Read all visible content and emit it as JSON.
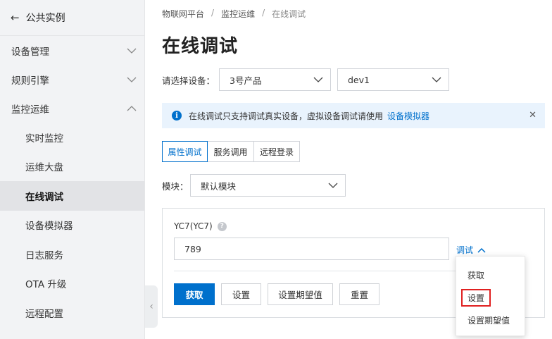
{
  "sidebar": {
    "back_label": "公共实例",
    "groups": [
      {
        "label": "设备管理"
      },
      {
        "label": "规则引擎"
      },
      {
        "label": "监控运维"
      }
    ],
    "subitems": [
      {
        "label": "实时监控"
      },
      {
        "label": "运维大盘"
      },
      {
        "label": "在线调试"
      },
      {
        "label": "设备模拟器"
      },
      {
        "label": "日志服务"
      },
      {
        "label": "OTA 升级"
      },
      {
        "label": "远程配置"
      }
    ]
  },
  "breadcrumb": [
    "物联网平台",
    "监控运维",
    "在线调试"
  ],
  "page_title": "在线调试",
  "device_select": {
    "label": "请选择设备：",
    "product": "3号产品",
    "device": "dev1"
  },
  "notice": {
    "text": "在线调试只支持调试真实设备，虚拟设备调试请使用",
    "link": "设备模拟器",
    "close": "✕"
  },
  "tabs": [
    {
      "label": "属性调试"
    },
    {
      "label": "服务调用"
    },
    {
      "label": "远程登录"
    }
  ],
  "module": {
    "label": "模块：",
    "value": "默认模块"
  },
  "property": {
    "name": "YC7(YC7)",
    "value": "789",
    "debug_link": "调试"
  },
  "buttons": {
    "fetch": "获取",
    "set": "设置",
    "set_expected": "设置期望值",
    "reset": "重置"
  },
  "dropdown": {
    "items": [
      "获取",
      "设置",
      "设置期望值"
    ],
    "highlighted": "设置"
  },
  "colors": {
    "accent": "#0070cc",
    "highlight_border": "#e02020",
    "sidebar_bg": "#f2f3f5",
    "notice_bg": "#e9f3fd"
  }
}
